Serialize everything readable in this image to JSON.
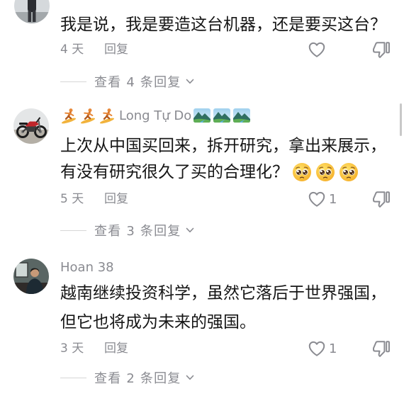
{
  "colors": {
    "background": "#ffffff",
    "text": "#161616",
    "meta": "#8a8b91",
    "divider": "#d6d6d6",
    "scrollbar": "#c8c8c8"
  },
  "comments": [
    {
      "avatar": "standing-person-photo-avatar",
      "text_lines": [
        "我是说，我是要造这台机器，还是要买这台？"
      ],
      "time": "4 天",
      "reply_label": "回复",
      "like_icon": "heart-outline-icon",
      "dislike_icon": "thumbs-down-icon",
      "view_replies": "查看 4 条回复",
      "view_replies_icon": "chevron-down-icon"
    },
    {
      "avatar": "motorcycle-photo-avatar",
      "username": "Long Tự Do",
      "username_prefix_icons": [
        "surfer-emoji-icon",
        "surfer-emoji-icon",
        "surfer-emoji-icon"
      ],
      "username_suffix_icons": [
        "national-park-emoji-icon",
        "national-park-emoji-icon",
        "national-park-emoji-icon"
      ],
      "text_lines": [
        "上次从中国买回来，拆开研究，拿出来展示，",
        "有没有研究很久了买的合理化？"
      ],
      "text_trailing_icons": [
        "pleading-face-emoji-icon",
        "pleading-face-emoji-icon",
        "pleading-face-emoji-icon"
      ],
      "time": "5 天",
      "reply_label": "回复",
      "like_icon": "heart-outline-icon",
      "like_count": "1",
      "dislike_icon": "thumbs-down-icon",
      "view_replies": "查看 3 条回复",
      "view_replies_icon": "chevron-down-icon"
    },
    {
      "avatar": "person-in-room-photo-avatar",
      "username": "Hoan 38",
      "text_lines": [
        "越南继续投资科学，虽然它落后于世界强国，",
        "但它也将成为未来的强国。"
      ],
      "time": "3 天",
      "reply_label": "回复",
      "like_icon": "heart-outline-icon",
      "like_count": "1",
      "dislike_icon": "thumbs-down-icon",
      "view_replies": "查看 2 条回复",
      "view_replies_icon": "chevron-down-icon"
    }
  ]
}
